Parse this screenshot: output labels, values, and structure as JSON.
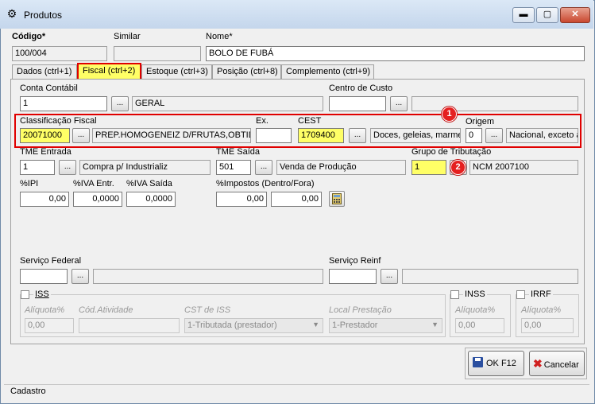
{
  "window": {
    "title": "Produtos",
    "min_label": "▬",
    "max_label": "▢",
    "close_label": "✕"
  },
  "header": {
    "codigo_label": "Código*",
    "codigo_value": "100/004",
    "similar_label": "Similar",
    "similar_value": "",
    "nome_label": "Nome*",
    "nome_value": "BOLO DE FUBÁ"
  },
  "tabs": [
    {
      "label": "Dados (ctrl+1)"
    },
    {
      "label": "Fiscal (ctrl+2)"
    },
    {
      "label": "Estoque (ctrl+3)"
    },
    {
      "label": "Posição (ctrl+8)"
    },
    {
      "label": "Complemento (ctrl+9)"
    }
  ],
  "fiscal": {
    "conta_contabil_label": "Conta Contábil",
    "conta_contabil_code": "1",
    "conta_contabil_desc": "GERAL",
    "centro_custo_label": "Centro de Custo",
    "centro_custo_code": "",
    "centro_custo_desc": "",
    "classificacao_label": "Classificação Fiscal",
    "classificacao_code": "20071000",
    "classificacao_desc": "PREP.HOMOGENEIZ D/FRUTAS,OBTIDOS",
    "ex_label": "Ex.",
    "ex_value": "",
    "cest_label": "CEST",
    "cest_code": "1709400",
    "cest_desc": "Doces, geleias, marme",
    "origem_label": "Origem",
    "origem_code": "0",
    "origem_desc": "Nacional, exceto a",
    "tme_entrada_label": "TME Entrada",
    "tme_entrada_code": "1",
    "tme_entrada_desc": "Compra p/ Industrializ",
    "tme_saida_label": "TME Saída",
    "tme_saida_code": "501",
    "tme_saida_desc": "Venda de Produção",
    "grupo_trib_label": "Grupo de Tributação",
    "grupo_trib_code": "1",
    "grupo_trib_desc": "NCM 2007100",
    "ipi_label": "%IPI",
    "ipi_value": "0,00",
    "iva_entr_label": "%IVA Entr.",
    "iva_entr_value": "0,0000",
    "iva_saida_label": "%IVA Saída",
    "iva_saida_value": "0,0000",
    "impostos_label": "%Impostos (Dentro/Fora)",
    "impostos_dentro": "0,00",
    "impostos_fora": "0,00",
    "servico_federal_label": "Serviço Federal",
    "servico_federal_code": "",
    "servico_federal_desc": "",
    "servico_reinf_label": "Serviço Reinf",
    "servico_reinf_code": "",
    "servico_reinf_desc": "",
    "iss_label": "ISS",
    "aliquota_label": "Alíquota%",
    "aliquota_value": "0,00",
    "cod_atividade_label": "Cód.Atividade",
    "cod_atividade_value": "",
    "cst_iss_label": "CST de ISS",
    "cst_iss_value": "1-Tributada (prestador)",
    "local_prestacao_label": "Local Prestação",
    "local_prestacao_value": "1-Prestador",
    "inss_label": "INSS",
    "inss_aliquota_label": "Alíquota%",
    "inss_aliquota_value": "0,00",
    "irrf_label": "IRRF",
    "irrf_aliquota_label": "Alíquota%",
    "irrf_aliquota_value": "0,00",
    "ellipsis": "..."
  },
  "annotations": {
    "badge1": "1",
    "badge2": "2"
  },
  "actions": {
    "ok_label": "OK  F12",
    "cancel_label": "Cancelar"
  },
  "status": {
    "text": "Cadastro"
  },
  "colors": {
    "highlight": "#ffff66",
    "annotation_red": "#e00000"
  }
}
